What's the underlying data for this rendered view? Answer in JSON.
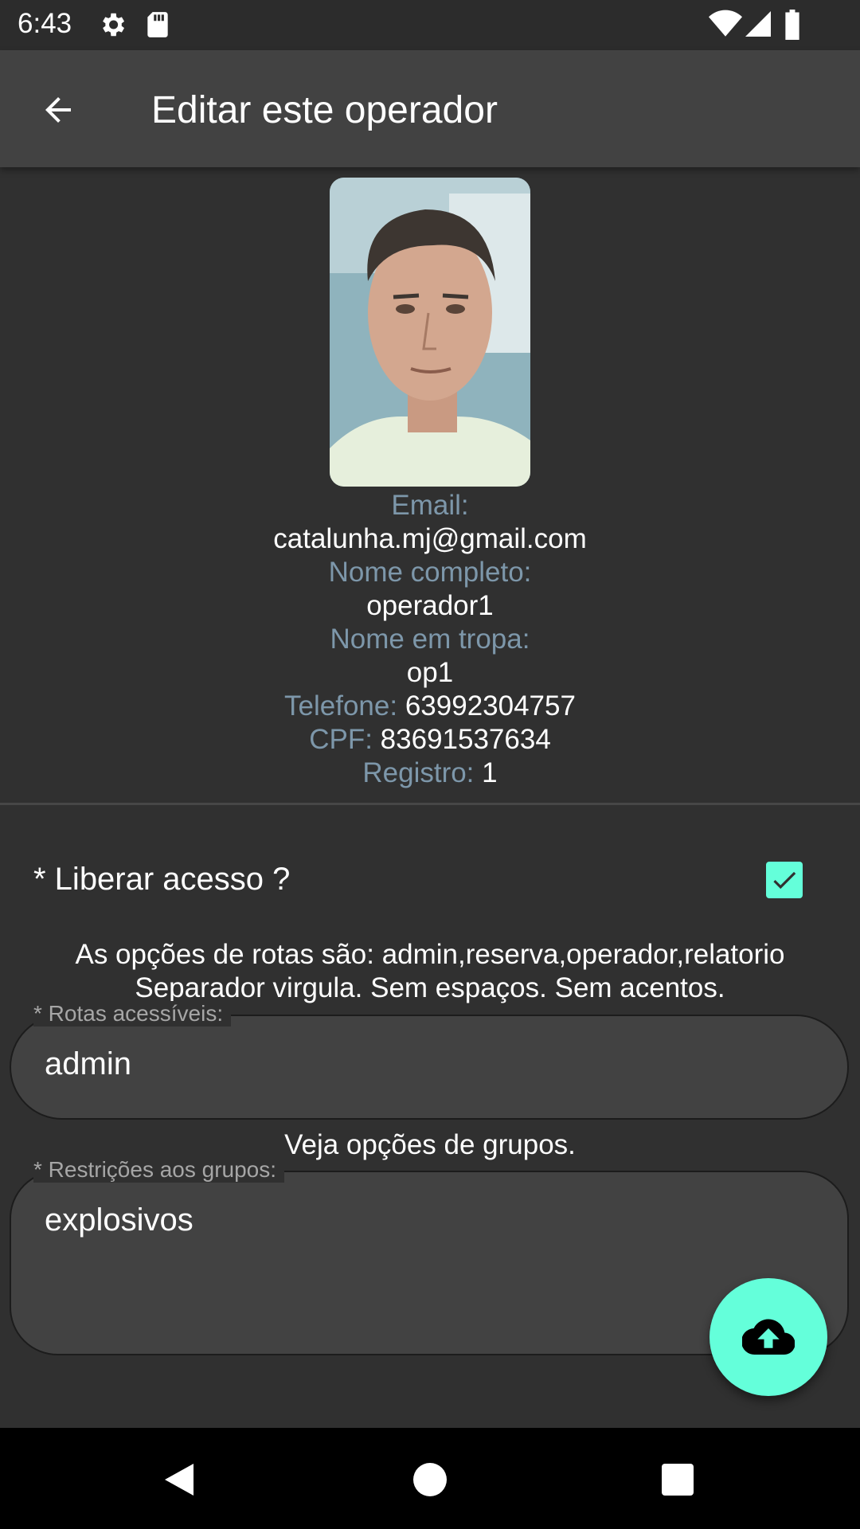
{
  "status_bar": {
    "time": "6:43"
  },
  "app_bar": {
    "title": "Editar este operador"
  },
  "profile": {
    "email_label": "Email:",
    "email": "catalunha.mj@gmail.com",
    "nome_label": "Nome completo:",
    "nome": "operador1",
    "tropa_label": "Nome em tropa:",
    "tropa": "op1",
    "telefone_label": "Telefone:",
    "telefone": "63992304757",
    "cpf_label": "CPF:",
    "cpf": "83691537634",
    "registro_label": "Registro:",
    "registro": "1"
  },
  "access": {
    "label": "* Liberar acesso ?",
    "checked": true
  },
  "help": {
    "line1": "As opções de rotas são: admin,reserva,operador,relatorio",
    "line2": "Separador virgula. Sem espaços. Sem acentos.",
    "grupos": "Veja opções de grupos."
  },
  "fields": {
    "rotas_label": "* Rotas acessíveis:",
    "rotas_value": "admin",
    "grupos_label": "* Restrições aos grupos:",
    "grupos_value": "explosivos"
  },
  "colors": {
    "accent": "#64ffda",
    "label": "#7d97aa",
    "background": "#303030",
    "app_bar": "#424242"
  },
  "icons": {
    "back": "arrow-back-icon",
    "fab": "cloud-upload-icon",
    "nav": [
      "back-triangle-icon",
      "home-circle-icon",
      "recents-square-icon"
    ]
  }
}
